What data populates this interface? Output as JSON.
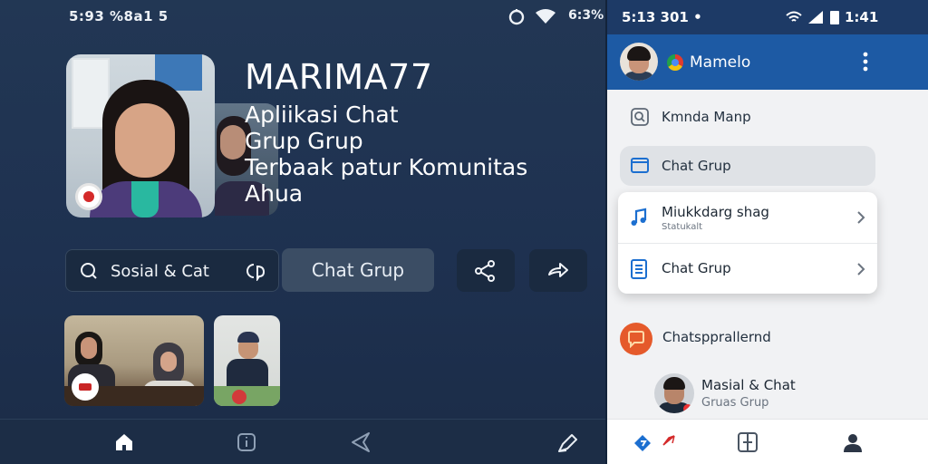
{
  "left_screen": {
    "status": {
      "time_text": "5:93 %8а1 5",
      "battery_text": "6:3%"
    },
    "hero": {
      "title": "MARIMA77",
      "subtitle_lines": [
        "Apliikasi Chat",
        "Grup Grup",
        "Terbaak patur Komunitas",
        "Ahua"
      ]
    },
    "search": {
      "label": "Sosial & Cat"
    },
    "chat_button": {
      "label": "Chat Grup"
    },
    "icons": {
      "search": "search-icon",
      "chat": "chat-bubble-icon",
      "share": "share-icon",
      "forward": "forward-arrow-icon",
      "home": "home-icon",
      "info": "info-icon",
      "send": "send-icon",
      "edit": "edit-icon"
    }
  },
  "right_screen": {
    "status": {
      "time_text": "5:13 301 •",
      "clock_text": "1:41"
    },
    "appbar": {
      "title": "Mamelo"
    },
    "menu": [
      {
        "label": "Kmnda Manp",
        "icon": "search-card-icon",
        "selected": false
      },
      {
        "label": "Chat Grup",
        "icon": "window-icon",
        "selected": true
      }
    ],
    "card": [
      {
        "label": "Miukkdarg shag",
        "sub": "Statukalt",
        "icon": "music-note-icon"
      },
      {
        "label": "Chat Grup",
        "sub": "",
        "icon": "document-icon"
      }
    ],
    "chat_item": {
      "label": "Chatspprallernd"
    },
    "contact": {
      "name": "Masial & Chat",
      "status": "Gruas Grup"
    }
  },
  "colors": {
    "left_bg": "#1e3150",
    "appbar_blue": "#1d5aa4",
    "status_blue": "#1d3a66",
    "accent_orange": "#e55a2b",
    "icon_blue": "#1c6fd0"
  }
}
